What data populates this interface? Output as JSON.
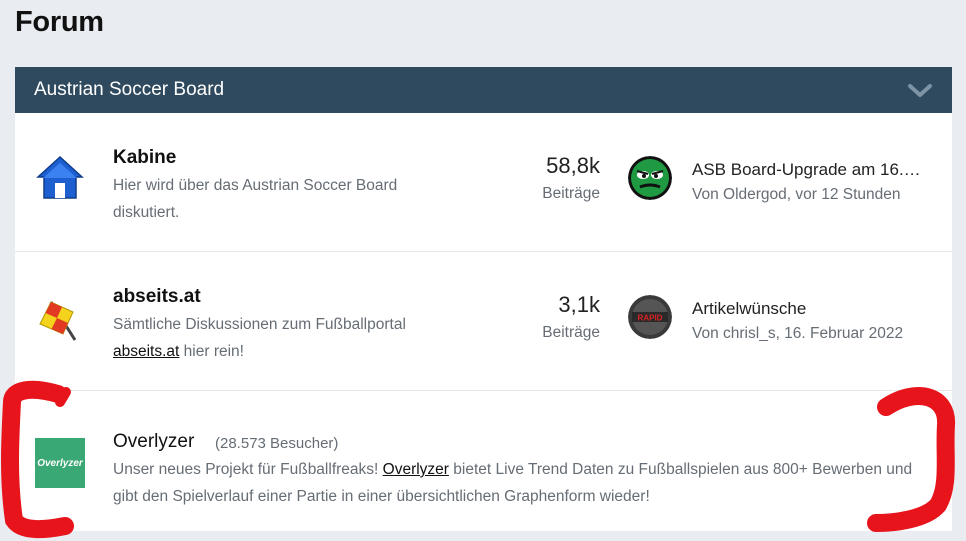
{
  "page": {
    "title": "Forum"
  },
  "category": {
    "title": "Austrian Soccer Board"
  },
  "forums": [
    {
      "title": "Kabine",
      "description": "Hier wird über das Austrian Soccer Board diskutiert.",
      "count": "58,8k",
      "count_label": "Beiträge",
      "last_post_title": "ASB Board-Upgrade am 16.…",
      "last_post_meta": "Von Oldergod, vor 12 Stunden",
      "icon": "house-icon"
    },
    {
      "title": "abseits.at",
      "description_pre": "Sämtliche Diskussionen zum Fußballportal",
      "description_link": "abseits.at",
      "description_post": " hier rein!",
      "count": "3,1k",
      "count_label": "Beiträge",
      "last_post_title": "Artikelwünsche",
      "last_post_meta": "Von chrisl_s, 16. Februar 2022",
      "icon": "linesman-flag-icon"
    }
  ],
  "ad_forum": {
    "title": "Overlyzer",
    "visitors": "(28.573 Besucher)",
    "desc_pre": "Unser neues Projekt für Fußballfreaks! ",
    "desc_link": "Overlyzer",
    "desc_post": " bietet Live Trend Daten zu Fußballspielen aus 800+ Bewerben und gibt den Spielverlauf einer Partie in einer übersichtlichen Graphenform wieder!",
    "logo_text": "Overlyzer",
    "logo_color": "#3aa874"
  },
  "colors": {
    "header_bg": "#2f4a5e",
    "page_bg": "#e9edf2",
    "annotation": "#e8141c"
  }
}
